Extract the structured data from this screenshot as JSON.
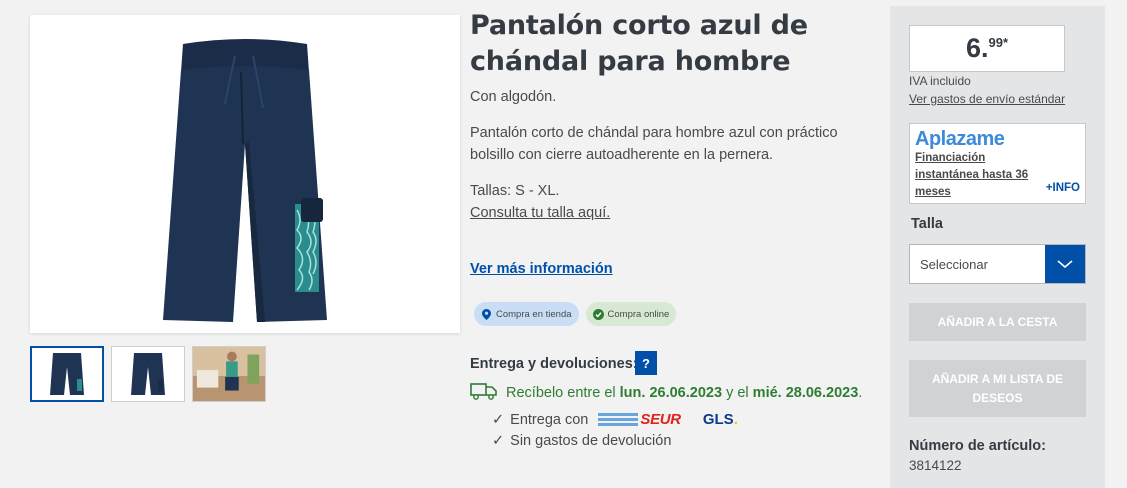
{
  "product": {
    "title": "Pantalón corto azul de chándal para hombre",
    "subtitle": "Con algodón.",
    "description": "Pantalón corto de chándal para hombre azul con práctico bolsillo con cierre autoadherente en la pernera.",
    "sizes": "Tallas: S - XL.",
    "size_link": "Consulta tu talla aquí.",
    "more_info": "Ver más información"
  },
  "badges": {
    "store": "Compra en tienda",
    "online": "Compra online"
  },
  "delivery": {
    "title": "Entrega y devoluciones:",
    "help": "?",
    "receive_prefix": "Recíbelo entre el",
    "date_from": "lun. 26.06.2023",
    "and": "y el",
    "date_to": "mié. 28.06.2023",
    "date_suffix": ".",
    "carrier_prefix": "Entrega con",
    "carrier_seur": "SEUR",
    "carrier_gls": "GLS",
    "carrier_gls_dot": ".",
    "no_return_cost": "Sin gastos de devolución",
    "check": "✓"
  },
  "price": {
    "main": "6.",
    "cents": "99*",
    "vat": "IVA incluido",
    "shipping_link": "Ver gastos de envío estándar"
  },
  "financing": {
    "logo": "Aplazame",
    "text": "Financiación instantánea hasta 36 meses",
    "more": "+INFO"
  },
  "size_select": {
    "label": "Talla",
    "value": "Seleccionar"
  },
  "actions": {
    "add_to_cart": "AÑADIR A LA CESTA",
    "add_to_wishlist": "AÑADIR A MI LISTA DE DESEOS"
  },
  "article": {
    "label": "Número de artículo:",
    "number": "3814122"
  },
  "colors": {
    "brand_blue": "#0050aa",
    "delivery_green": "#2e7d32",
    "shorts_navy": "#1f3352",
    "disabled_button": "#d0d2d4"
  },
  "icons": {
    "location": "location-pin-icon",
    "online": "check-circle-icon",
    "truck": "truck-icon",
    "chevron": "chevron-down-icon"
  }
}
